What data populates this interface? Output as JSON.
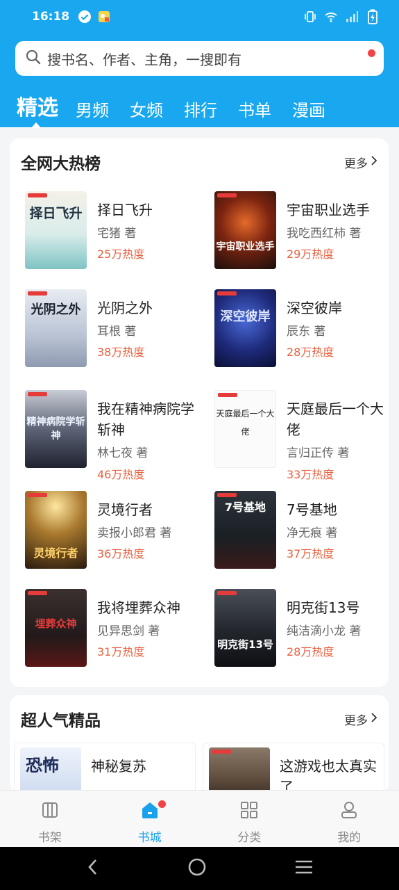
{
  "status": {
    "time": "16:18"
  },
  "search": {
    "placeholder": "搜书名、作者、主角，一搜即有"
  },
  "tabs": [
    {
      "label": "精选"
    },
    {
      "label": "男频"
    },
    {
      "label": "女频"
    },
    {
      "label": "排行"
    },
    {
      "label": "书单"
    },
    {
      "label": "漫画"
    }
  ],
  "hot": {
    "title": "全网大热榜",
    "more": "更多",
    "books": [
      {
        "title": "择日飞升",
        "author": "宅猪 著",
        "heat": "25万热度",
        "cover_text": "择日飞升"
      },
      {
        "title": "宇宙职业选手",
        "author": "我吃西红柿 著",
        "heat": "29万热度",
        "cover_text": "宇宙职业选手"
      },
      {
        "title": "光阴之外",
        "author": "耳根 著",
        "heat": "38万热度",
        "cover_text": "光阴之外"
      },
      {
        "title": "深空彼岸",
        "author": "辰东 著",
        "heat": "28万热度",
        "cover_text": "深空彼岸"
      },
      {
        "title": "我在精神病院学斩神",
        "author": "林七夜 著",
        "heat": "46万热度",
        "cover_text": "精神病院学斩神"
      },
      {
        "title": "天庭最后一个大佬",
        "author": "言归正传 著",
        "heat": "33万热度",
        "cover_text": "天庭最后一个大佬"
      },
      {
        "title": "灵境行者",
        "author": "卖报小郎君 著",
        "heat": "36万热度",
        "cover_text": "灵境行者"
      },
      {
        "title": "7号基地",
        "author": "净无痕 著",
        "heat": "37万热度",
        "cover_text": "7号基地"
      },
      {
        "title": "我将埋葬众神",
        "author": "见异思剑 著",
        "heat": "31万热度",
        "cover_text": "埋葬众神"
      },
      {
        "title": "明克街13号",
        "author": "纯洁滴小龙 著",
        "heat": "28万热度",
        "cover_text": "明克街13号"
      }
    ]
  },
  "popular": {
    "title": "超人气精品",
    "more": "更多",
    "books": [
      {
        "title": "神秘复苏",
        "cover_text": "恐怖"
      },
      {
        "title": "这游戏也太真实了"
      }
    ]
  },
  "nav": [
    {
      "label": "书架"
    },
    {
      "label": "书城"
    },
    {
      "label": "分类"
    },
    {
      "label": "我的"
    }
  ],
  "colors": {
    "brand": "#19a7f0",
    "heat": "#e9603f",
    "badge": "#f04444"
  }
}
